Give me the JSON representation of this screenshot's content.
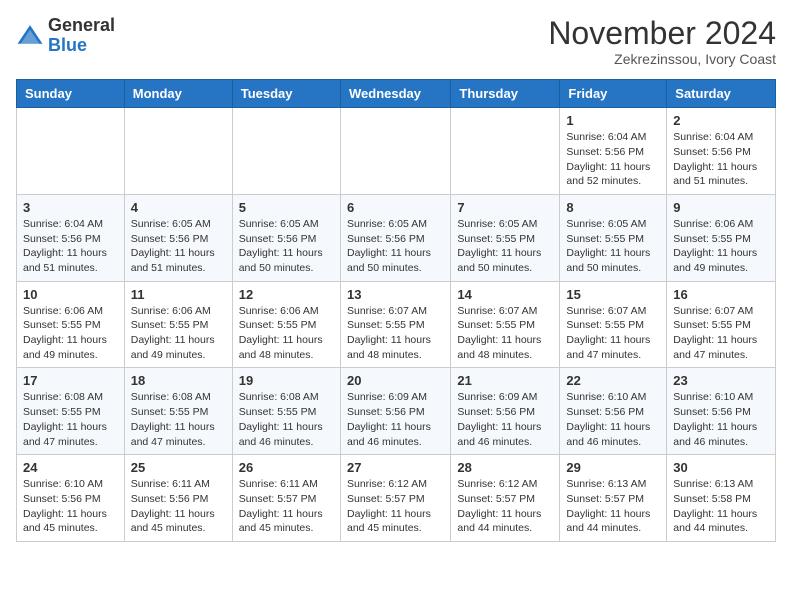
{
  "header": {
    "logo_general": "General",
    "logo_blue": "Blue",
    "month_title": "November 2024",
    "location": "Zekrezinssou, Ivory Coast"
  },
  "columns": [
    "Sunday",
    "Monday",
    "Tuesday",
    "Wednesday",
    "Thursday",
    "Friday",
    "Saturday"
  ],
  "weeks": [
    [
      {
        "day": "",
        "info": ""
      },
      {
        "day": "",
        "info": ""
      },
      {
        "day": "",
        "info": ""
      },
      {
        "day": "",
        "info": ""
      },
      {
        "day": "",
        "info": ""
      },
      {
        "day": "1",
        "info": "Sunrise: 6:04 AM\nSunset: 5:56 PM\nDaylight: 11 hours\nand 52 minutes."
      },
      {
        "day": "2",
        "info": "Sunrise: 6:04 AM\nSunset: 5:56 PM\nDaylight: 11 hours\nand 51 minutes."
      }
    ],
    [
      {
        "day": "3",
        "info": "Sunrise: 6:04 AM\nSunset: 5:56 PM\nDaylight: 11 hours\nand 51 minutes."
      },
      {
        "day": "4",
        "info": "Sunrise: 6:05 AM\nSunset: 5:56 PM\nDaylight: 11 hours\nand 51 minutes."
      },
      {
        "day": "5",
        "info": "Sunrise: 6:05 AM\nSunset: 5:56 PM\nDaylight: 11 hours\nand 50 minutes."
      },
      {
        "day": "6",
        "info": "Sunrise: 6:05 AM\nSunset: 5:56 PM\nDaylight: 11 hours\nand 50 minutes."
      },
      {
        "day": "7",
        "info": "Sunrise: 6:05 AM\nSunset: 5:55 PM\nDaylight: 11 hours\nand 50 minutes."
      },
      {
        "day": "8",
        "info": "Sunrise: 6:05 AM\nSunset: 5:55 PM\nDaylight: 11 hours\nand 50 minutes."
      },
      {
        "day": "9",
        "info": "Sunrise: 6:06 AM\nSunset: 5:55 PM\nDaylight: 11 hours\nand 49 minutes."
      }
    ],
    [
      {
        "day": "10",
        "info": "Sunrise: 6:06 AM\nSunset: 5:55 PM\nDaylight: 11 hours\nand 49 minutes."
      },
      {
        "day": "11",
        "info": "Sunrise: 6:06 AM\nSunset: 5:55 PM\nDaylight: 11 hours\nand 49 minutes."
      },
      {
        "day": "12",
        "info": "Sunrise: 6:06 AM\nSunset: 5:55 PM\nDaylight: 11 hours\nand 48 minutes."
      },
      {
        "day": "13",
        "info": "Sunrise: 6:07 AM\nSunset: 5:55 PM\nDaylight: 11 hours\nand 48 minutes."
      },
      {
        "day": "14",
        "info": "Sunrise: 6:07 AM\nSunset: 5:55 PM\nDaylight: 11 hours\nand 48 minutes."
      },
      {
        "day": "15",
        "info": "Sunrise: 6:07 AM\nSunset: 5:55 PM\nDaylight: 11 hours\nand 47 minutes."
      },
      {
        "day": "16",
        "info": "Sunrise: 6:07 AM\nSunset: 5:55 PM\nDaylight: 11 hours\nand 47 minutes."
      }
    ],
    [
      {
        "day": "17",
        "info": "Sunrise: 6:08 AM\nSunset: 5:55 PM\nDaylight: 11 hours\nand 47 minutes."
      },
      {
        "day": "18",
        "info": "Sunrise: 6:08 AM\nSunset: 5:55 PM\nDaylight: 11 hours\nand 47 minutes."
      },
      {
        "day": "19",
        "info": "Sunrise: 6:08 AM\nSunset: 5:55 PM\nDaylight: 11 hours\nand 46 minutes."
      },
      {
        "day": "20",
        "info": "Sunrise: 6:09 AM\nSunset: 5:56 PM\nDaylight: 11 hours\nand 46 minutes."
      },
      {
        "day": "21",
        "info": "Sunrise: 6:09 AM\nSunset: 5:56 PM\nDaylight: 11 hours\nand 46 minutes."
      },
      {
        "day": "22",
        "info": "Sunrise: 6:10 AM\nSunset: 5:56 PM\nDaylight: 11 hours\nand 46 minutes."
      },
      {
        "day": "23",
        "info": "Sunrise: 6:10 AM\nSunset: 5:56 PM\nDaylight: 11 hours\nand 46 minutes."
      }
    ],
    [
      {
        "day": "24",
        "info": "Sunrise: 6:10 AM\nSunset: 5:56 PM\nDaylight: 11 hours\nand 45 minutes."
      },
      {
        "day": "25",
        "info": "Sunrise: 6:11 AM\nSunset: 5:56 PM\nDaylight: 11 hours\nand 45 minutes."
      },
      {
        "day": "26",
        "info": "Sunrise: 6:11 AM\nSunset: 5:57 PM\nDaylight: 11 hours\nand 45 minutes."
      },
      {
        "day": "27",
        "info": "Sunrise: 6:12 AM\nSunset: 5:57 PM\nDaylight: 11 hours\nand 45 minutes."
      },
      {
        "day": "28",
        "info": "Sunrise: 6:12 AM\nSunset: 5:57 PM\nDaylight: 11 hours\nand 44 minutes."
      },
      {
        "day": "29",
        "info": "Sunrise: 6:13 AM\nSunset: 5:57 PM\nDaylight: 11 hours\nand 44 minutes."
      },
      {
        "day": "30",
        "info": "Sunrise: 6:13 AM\nSunset: 5:58 PM\nDaylight: 11 hours\nand 44 minutes."
      }
    ]
  ]
}
